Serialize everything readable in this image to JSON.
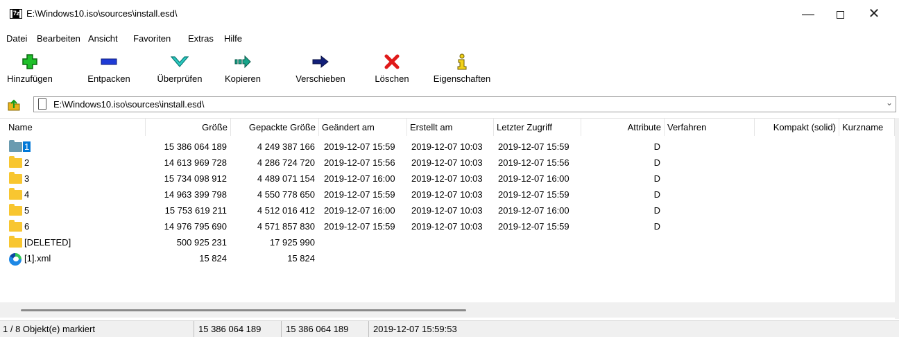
{
  "window": {
    "app_icon_text": "7z",
    "title": "E:\\Windows10.iso\\sources\\install.esd\\"
  },
  "menu": [
    "Datei",
    "Bearbeiten",
    "Ansicht",
    "Favoriten",
    "Extras",
    "Hilfe"
  ],
  "toolbar": {
    "add": "Hinzufügen",
    "extract": "Entpacken",
    "test": "Überprüfen",
    "copy": "Kopieren",
    "move": "Verschieben",
    "delete": "Löschen",
    "info": "Eigenschaften"
  },
  "address": {
    "path": "E:\\Windows10.iso\\sources\\install.esd\\"
  },
  "columns": {
    "name": "Name",
    "size": "Größe",
    "packed": "Gepackte Größe",
    "modified": "Geändert am",
    "created": "Erstellt am",
    "accessed": "Letzter Zugriff",
    "attributes": "Attribute",
    "method": "Verfahren",
    "solid": "Kompakt (solid)",
    "short": "Kurzname"
  },
  "rows": [
    {
      "name": "1",
      "size": "15 386 064 189",
      "packed": "4 249 387 166",
      "modified": "2019-12-07 15:59",
      "created": "2019-12-07 10:03",
      "accessed": "2019-12-07 15:59",
      "attributes": "D"
    },
    {
      "name": "2",
      "size": "14 613 969 728",
      "packed": "4 286 724 720",
      "modified": "2019-12-07 15:56",
      "created": "2019-12-07 10:03",
      "accessed": "2019-12-07 15:56",
      "attributes": "D"
    },
    {
      "name": "3",
      "size": "15 734 098 912",
      "packed": "4 489 071 154",
      "modified": "2019-12-07 16:00",
      "created": "2019-12-07 10:03",
      "accessed": "2019-12-07 16:00",
      "attributes": "D"
    },
    {
      "name": "4",
      "size": "14 963 399 798",
      "packed": "4 550 778 650",
      "modified": "2019-12-07 15:59",
      "created": "2019-12-07 10:03",
      "accessed": "2019-12-07 15:59",
      "attributes": "D"
    },
    {
      "name": "5",
      "size": "15 753 619 211",
      "packed": "4 512 016 412",
      "modified": "2019-12-07 16:00",
      "created": "2019-12-07 10:03",
      "accessed": "2019-12-07 16:00",
      "attributes": "D"
    },
    {
      "name": "6",
      "size": "14 976 795 690",
      "packed": "4 571 857 830",
      "modified": "2019-12-07 15:59",
      "created": "2019-12-07 10:03",
      "accessed": "2019-12-07 15:59",
      "attributes": "D"
    },
    {
      "name": "[DELETED]",
      "size": "500 925 231",
      "packed": "17 925 990",
      "modified": "",
      "created": "",
      "accessed": "",
      "attributes": ""
    },
    {
      "name": "[1].xml",
      "size": "15 824",
      "packed": "15 824",
      "modified": "",
      "created": "",
      "accessed": "",
      "attributes": ""
    }
  ],
  "status": {
    "selection": "1 / 8 Objekt(e) markiert",
    "size": "15 386 064 189",
    "size2": "15 386 064 189",
    "date": "2019-12-07 15:59:53"
  },
  "colors": {
    "selection": "#0078d7",
    "folder": "#f8c630",
    "folder_selected": "#6a9bb0"
  }
}
